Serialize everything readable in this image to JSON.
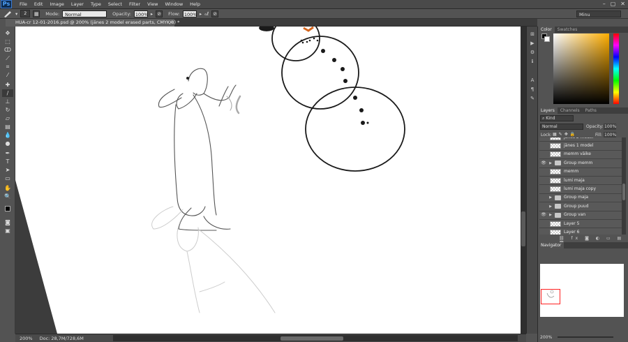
{
  "app": {
    "logo": "Ps"
  },
  "menu": [
    "File",
    "Edit",
    "Image",
    "Layer",
    "Type",
    "Select",
    "Filter",
    "View",
    "Window",
    "Help"
  ],
  "window_controls": [
    "–",
    "▢",
    "✕"
  ],
  "options_bar": {
    "brush_size": "2",
    "mode_label": "Mode:",
    "mode_value": "Normal",
    "opacity_label": "Opacity:",
    "opacity_value": "100%",
    "flow_label": "Flow:",
    "flow_value": "100%",
    "workspace": "Minu"
  },
  "document_tab": {
    "title": "HUA-cr 12-01-2016.psd @ 200% (jänes 2 model erased parts, CMYK/8) *",
    "close": "×"
  },
  "status_bar": {
    "zoom": "200%",
    "doc_info": "Doc: 28,7M/728,6M"
  },
  "color_panel": {
    "tabs": [
      "Color",
      "Swatches"
    ],
    "accent_hue": "#ffae00"
  },
  "layers_panel": {
    "tabs": [
      "Layers",
      "Channels",
      "Paths"
    ],
    "filter_kind": "Kind",
    "blend_mode": "Normal",
    "opacity_label": "Opacity:",
    "opacity_value": "100%",
    "lock_label": "Lock:",
    "fill_label": "Fill:",
    "fill_value": "100%",
    "layers": [
      {
        "name": "jänes 2 model",
        "type": "layer",
        "visible": false
      },
      {
        "name": "jänes 1 model",
        "type": "layer",
        "visible": false
      },
      {
        "name": "memm väike",
        "type": "layer",
        "visible": false
      },
      {
        "name": "Group memm",
        "type": "group",
        "visible": true
      },
      {
        "name": "memm",
        "type": "layer",
        "visible": false
      },
      {
        "name": "lumi maja",
        "type": "layer",
        "visible": false
      },
      {
        "name": "lumi maja copy",
        "type": "layer",
        "visible": false
      },
      {
        "name": "Group maja",
        "type": "group",
        "visible": false
      },
      {
        "name": "Group puud",
        "type": "group",
        "visible": false
      },
      {
        "name": "Group van",
        "type": "group",
        "visible": true
      },
      {
        "name": "Layer 5",
        "type": "layer",
        "visible": false
      },
      {
        "name": "Layer 6",
        "type": "layer",
        "visible": false
      }
    ]
  },
  "navigator": {
    "title": "Navigator",
    "zoom": "200%"
  }
}
